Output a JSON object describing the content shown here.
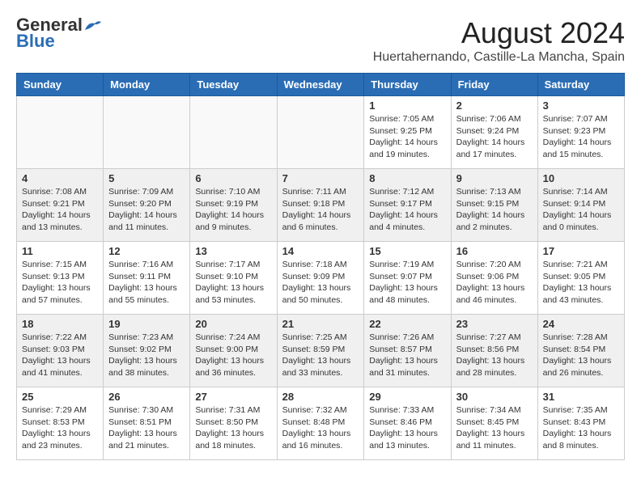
{
  "header": {
    "logo_general": "General",
    "logo_blue": "Blue",
    "month_year": "August 2024",
    "location": "Huertahernando, Castille-La Mancha, Spain"
  },
  "days_of_week": [
    "Sunday",
    "Monday",
    "Tuesday",
    "Wednesday",
    "Thursday",
    "Friday",
    "Saturday"
  ],
  "weeks": [
    {
      "shaded": false,
      "days": [
        {
          "num": "",
          "info": ""
        },
        {
          "num": "",
          "info": ""
        },
        {
          "num": "",
          "info": ""
        },
        {
          "num": "",
          "info": ""
        },
        {
          "num": "1",
          "info": "Sunrise: 7:05 AM\nSunset: 9:25 PM\nDaylight: 14 hours\nand 19 minutes."
        },
        {
          "num": "2",
          "info": "Sunrise: 7:06 AM\nSunset: 9:24 PM\nDaylight: 14 hours\nand 17 minutes."
        },
        {
          "num": "3",
          "info": "Sunrise: 7:07 AM\nSunset: 9:23 PM\nDaylight: 14 hours\nand 15 minutes."
        }
      ]
    },
    {
      "shaded": true,
      "days": [
        {
          "num": "4",
          "info": "Sunrise: 7:08 AM\nSunset: 9:21 PM\nDaylight: 14 hours\nand 13 minutes."
        },
        {
          "num": "5",
          "info": "Sunrise: 7:09 AM\nSunset: 9:20 PM\nDaylight: 14 hours\nand 11 minutes."
        },
        {
          "num": "6",
          "info": "Sunrise: 7:10 AM\nSunset: 9:19 PM\nDaylight: 14 hours\nand 9 minutes."
        },
        {
          "num": "7",
          "info": "Sunrise: 7:11 AM\nSunset: 9:18 PM\nDaylight: 14 hours\nand 6 minutes."
        },
        {
          "num": "8",
          "info": "Sunrise: 7:12 AM\nSunset: 9:17 PM\nDaylight: 14 hours\nand 4 minutes."
        },
        {
          "num": "9",
          "info": "Sunrise: 7:13 AM\nSunset: 9:15 PM\nDaylight: 14 hours\nand 2 minutes."
        },
        {
          "num": "10",
          "info": "Sunrise: 7:14 AM\nSunset: 9:14 PM\nDaylight: 14 hours\nand 0 minutes."
        }
      ]
    },
    {
      "shaded": false,
      "days": [
        {
          "num": "11",
          "info": "Sunrise: 7:15 AM\nSunset: 9:13 PM\nDaylight: 13 hours\nand 57 minutes."
        },
        {
          "num": "12",
          "info": "Sunrise: 7:16 AM\nSunset: 9:11 PM\nDaylight: 13 hours\nand 55 minutes."
        },
        {
          "num": "13",
          "info": "Sunrise: 7:17 AM\nSunset: 9:10 PM\nDaylight: 13 hours\nand 53 minutes."
        },
        {
          "num": "14",
          "info": "Sunrise: 7:18 AM\nSunset: 9:09 PM\nDaylight: 13 hours\nand 50 minutes."
        },
        {
          "num": "15",
          "info": "Sunrise: 7:19 AM\nSunset: 9:07 PM\nDaylight: 13 hours\nand 48 minutes."
        },
        {
          "num": "16",
          "info": "Sunrise: 7:20 AM\nSunset: 9:06 PM\nDaylight: 13 hours\nand 46 minutes."
        },
        {
          "num": "17",
          "info": "Sunrise: 7:21 AM\nSunset: 9:05 PM\nDaylight: 13 hours\nand 43 minutes."
        }
      ]
    },
    {
      "shaded": true,
      "days": [
        {
          "num": "18",
          "info": "Sunrise: 7:22 AM\nSunset: 9:03 PM\nDaylight: 13 hours\nand 41 minutes."
        },
        {
          "num": "19",
          "info": "Sunrise: 7:23 AM\nSunset: 9:02 PM\nDaylight: 13 hours\nand 38 minutes."
        },
        {
          "num": "20",
          "info": "Sunrise: 7:24 AM\nSunset: 9:00 PM\nDaylight: 13 hours\nand 36 minutes."
        },
        {
          "num": "21",
          "info": "Sunrise: 7:25 AM\nSunset: 8:59 PM\nDaylight: 13 hours\nand 33 minutes."
        },
        {
          "num": "22",
          "info": "Sunrise: 7:26 AM\nSunset: 8:57 PM\nDaylight: 13 hours\nand 31 minutes."
        },
        {
          "num": "23",
          "info": "Sunrise: 7:27 AM\nSunset: 8:56 PM\nDaylight: 13 hours\nand 28 minutes."
        },
        {
          "num": "24",
          "info": "Sunrise: 7:28 AM\nSunset: 8:54 PM\nDaylight: 13 hours\nand 26 minutes."
        }
      ]
    },
    {
      "shaded": false,
      "days": [
        {
          "num": "25",
          "info": "Sunrise: 7:29 AM\nSunset: 8:53 PM\nDaylight: 13 hours\nand 23 minutes."
        },
        {
          "num": "26",
          "info": "Sunrise: 7:30 AM\nSunset: 8:51 PM\nDaylight: 13 hours\nand 21 minutes."
        },
        {
          "num": "27",
          "info": "Sunrise: 7:31 AM\nSunset: 8:50 PM\nDaylight: 13 hours\nand 18 minutes."
        },
        {
          "num": "28",
          "info": "Sunrise: 7:32 AM\nSunset: 8:48 PM\nDaylight: 13 hours\nand 16 minutes."
        },
        {
          "num": "29",
          "info": "Sunrise: 7:33 AM\nSunset: 8:46 PM\nDaylight: 13 hours\nand 13 minutes."
        },
        {
          "num": "30",
          "info": "Sunrise: 7:34 AM\nSunset: 8:45 PM\nDaylight: 13 hours\nand 11 minutes."
        },
        {
          "num": "31",
          "info": "Sunrise: 7:35 AM\nSunset: 8:43 PM\nDaylight: 13 hours\nand 8 minutes."
        }
      ]
    }
  ]
}
